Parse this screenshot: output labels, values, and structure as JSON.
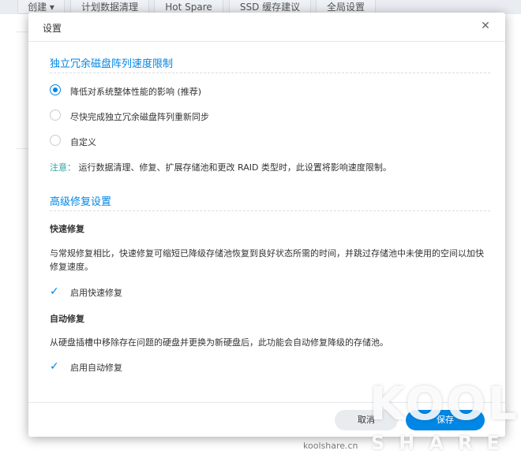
{
  "toolbar": {
    "tabs": [
      "创建 ▾",
      "计划数据清理",
      "Hot Spare",
      "SSD 缓存建议",
      "全局设置"
    ]
  },
  "dialog": {
    "title": "设置",
    "raid_section": {
      "title": "独立冗余磁盘阵列速度限制",
      "options": [
        "降低对系统整体性能的影响 (推荐)",
        "尽快完成独立冗余磁盘阵列重新同步",
        "自定义"
      ],
      "selected_index": 0,
      "note_label": "注意：",
      "note_text": "运行数据清理、修复、扩展存储池和更改 RAID 类型时，此设置将影响速度限制。"
    },
    "repair_section": {
      "title": "高级修复设置",
      "fast_repair": {
        "heading": "快速修复",
        "description": "与常规修复相比，快速修复可缩短已降级存储池恢复到良好状态所需的时间，并跳过存储池中未使用的空间以加快修复速度。",
        "checkbox_label": "启用快速修复",
        "checked": true
      },
      "auto_repair": {
        "heading": "自动修复",
        "description": "从硬盘插槽中移除存在问题的硬盘并更换为新硬盘后，此功能会自动修复降级的存储池。",
        "checkbox_label": "启用自动修复",
        "checked": true
      }
    },
    "buttons": {
      "cancel": "取消",
      "save": "保存"
    }
  },
  "watermark": {
    "logo": "KOOL",
    "share": "SHARE",
    "site": "koolshare.cn"
  },
  "colors": {
    "accent": "#0086e5",
    "note": "#2aa3a1"
  }
}
